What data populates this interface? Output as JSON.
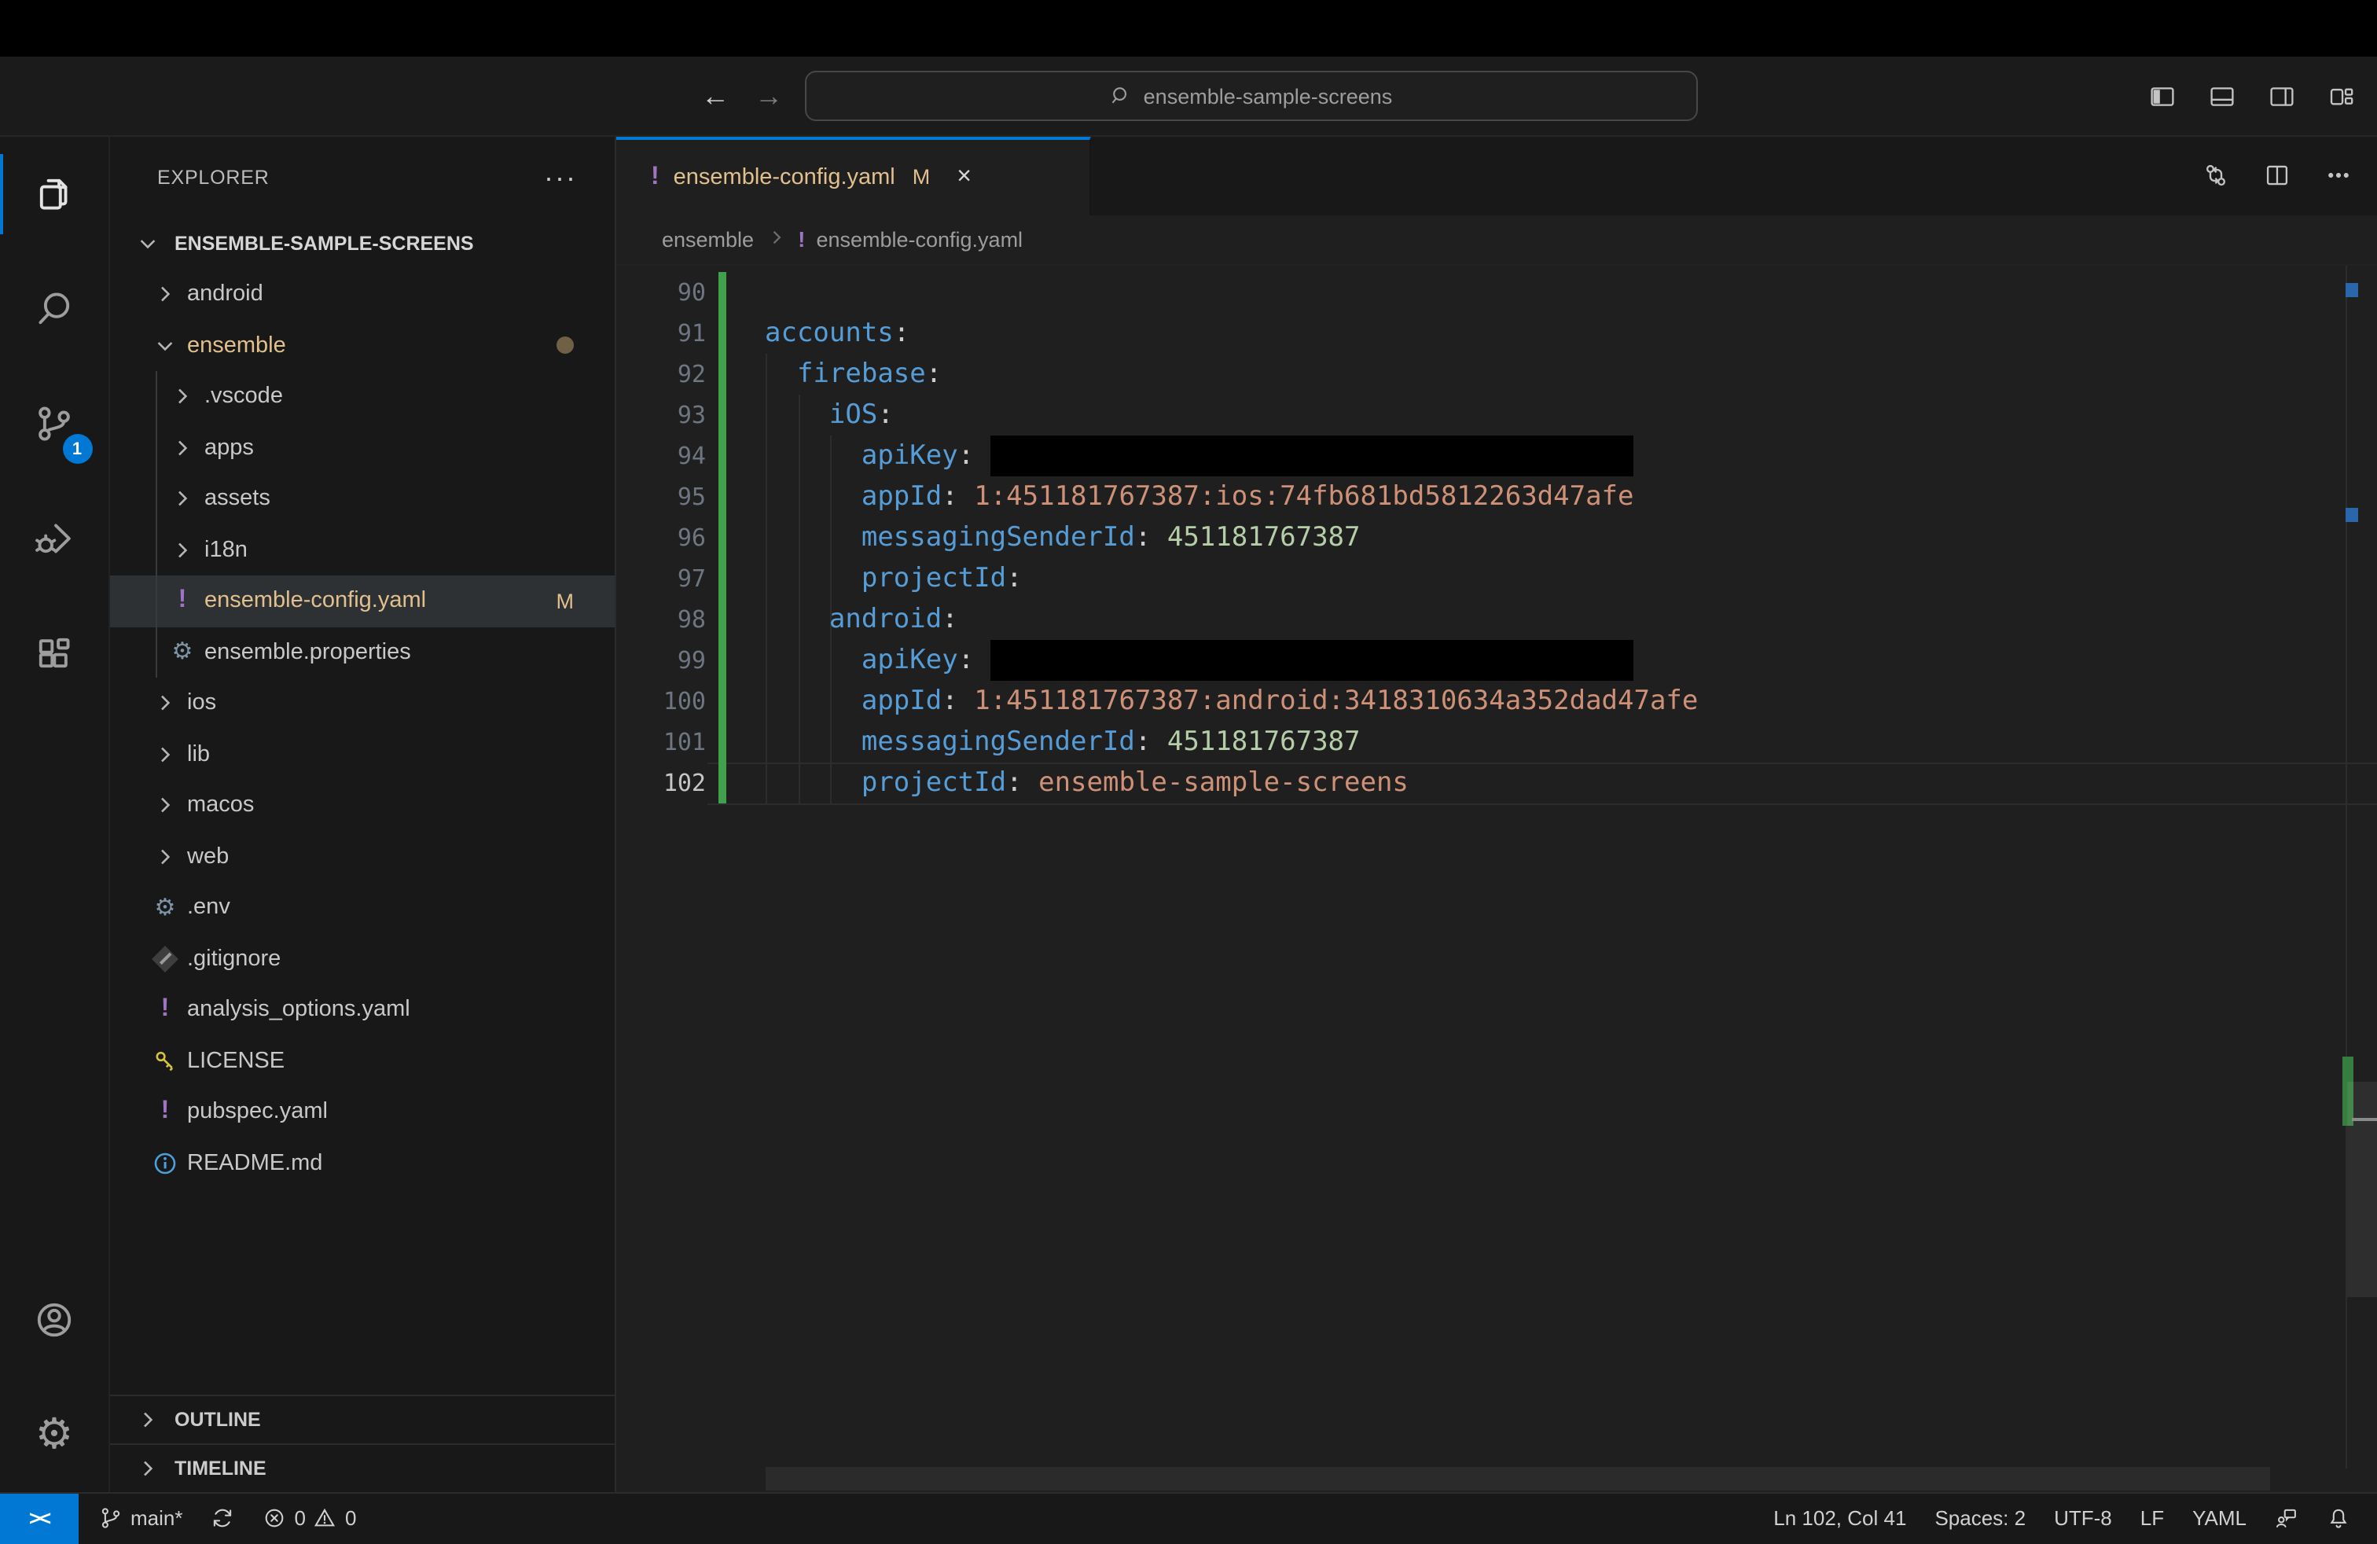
{
  "titlebar": {
    "back": "←",
    "forward": "→",
    "command_center": "ensemble-sample-screens"
  },
  "activity_bar": {
    "scm_badge": "1",
    "items": [
      "explorer",
      "search",
      "source-control",
      "run-and-debug",
      "extensions"
    ],
    "bottom": [
      "accounts",
      "settings"
    ]
  },
  "explorer": {
    "title": "EXPLORER",
    "more": "···",
    "root": "ENSEMBLE-SAMPLE-SCREENS",
    "items": [
      {
        "label": "android",
        "icon": "chevron-right",
        "level": 0
      },
      {
        "label": "ensemble",
        "icon": "chevron-down",
        "level": 0,
        "modified": true,
        "dot": true
      },
      {
        "label": ".vscode",
        "icon": "chevron-right",
        "level": 1
      },
      {
        "label": "apps",
        "icon": "chevron-right",
        "level": 1
      },
      {
        "label": "assets",
        "icon": "chevron-right",
        "level": 1
      },
      {
        "label": "i18n",
        "icon": "chevron-right",
        "level": 1
      },
      {
        "label": "ensemble-config.yaml",
        "icon": "yaml",
        "level": 1,
        "modified": true,
        "selected": true,
        "badge": "M"
      },
      {
        "label": "ensemble.properties",
        "icon": "gear",
        "level": 1
      },
      {
        "label": "ios",
        "icon": "chevron-right",
        "level": 0
      },
      {
        "label": "lib",
        "icon": "chevron-right",
        "level": 0
      },
      {
        "label": "macos",
        "icon": "chevron-right",
        "level": 0
      },
      {
        "label": "web",
        "icon": "chevron-right",
        "level": 0
      },
      {
        "label": ".env",
        "icon": "gear",
        "level": 0
      },
      {
        "label": ".gitignore",
        "icon": "git",
        "level": 0
      },
      {
        "label": "analysis_options.yaml",
        "icon": "yaml",
        "level": 0
      },
      {
        "label": "LICENSE",
        "icon": "key",
        "level": 0
      },
      {
        "label": "pubspec.yaml",
        "icon": "yaml",
        "level": 0
      },
      {
        "label": "README.md",
        "icon": "info",
        "level": 0
      }
    ],
    "sections": [
      "OUTLINE",
      "TIMELINE"
    ]
  },
  "tab": {
    "icon": "!",
    "label": "ensemble-config.yaml",
    "badge": "M",
    "close": "×"
  },
  "breadcrumb": {
    "folder": "ensemble",
    "file": "ensemble-config.yaml"
  },
  "editor": {
    "language": "yaml",
    "lines": [
      {
        "n": "90",
        "tokens": []
      },
      {
        "n": "91",
        "tokens": [
          [
            "k",
            "accounts"
          ],
          [
            "p",
            ":"
          ]
        ]
      },
      {
        "n": "92",
        "tokens": [
          [
            "w",
            "  "
          ],
          [
            "k",
            "firebase"
          ],
          [
            "p",
            ":"
          ]
        ]
      },
      {
        "n": "93",
        "tokens": [
          [
            "w",
            "    "
          ],
          [
            "k",
            "iOS"
          ],
          [
            "p",
            ":"
          ]
        ]
      },
      {
        "n": "94",
        "tokens": [
          [
            "w",
            "      "
          ],
          [
            "k",
            "apiKey"
          ],
          [
            "p",
            ":"
          ],
          [
            "w",
            " "
          ],
          [
            "r",
            ""
          ]
        ]
      },
      {
        "n": "95",
        "tokens": [
          [
            "w",
            "      "
          ],
          [
            "k",
            "appId"
          ],
          [
            "p",
            ":"
          ],
          [
            "w",
            " "
          ],
          [
            "s",
            "1:451181767387:ios:74fb681bd5812263d47afe"
          ]
        ]
      },
      {
        "n": "96",
        "tokens": [
          [
            "w",
            "      "
          ],
          [
            "k",
            "messagingSenderId"
          ],
          [
            "p",
            ":"
          ],
          [
            "w",
            " "
          ],
          [
            "n",
            "451181767387"
          ]
        ]
      },
      {
        "n": "97",
        "tokens": [
          [
            "w",
            "      "
          ],
          [
            "k",
            "projectId"
          ],
          [
            "p",
            ":"
          ]
        ]
      },
      {
        "n": "98",
        "tokens": [
          [
            "w",
            "    "
          ],
          [
            "k",
            "android"
          ],
          [
            "p",
            ":"
          ]
        ]
      },
      {
        "n": "99",
        "tokens": [
          [
            "w",
            "      "
          ],
          [
            "k",
            "apiKey"
          ],
          [
            "p",
            ":"
          ],
          [
            "w",
            " "
          ],
          [
            "r",
            ""
          ]
        ]
      },
      {
        "n": "100",
        "tokens": [
          [
            "w",
            "      "
          ],
          [
            "k",
            "appId"
          ],
          [
            "p",
            ":"
          ],
          [
            "w",
            " "
          ],
          [
            "s",
            "1:451181767387:android:3418310634a352dad47afe"
          ]
        ]
      },
      {
        "n": "101",
        "tokens": [
          [
            "w",
            "      "
          ],
          [
            "k",
            "messagingSenderId"
          ],
          [
            "p",
            ":"
          ],
          [
            "w",
            " "
          ],
          [
            "n",
            "451181767387"
          ]
        ]
      },
      {
        "n": "102",
        "tokens": [
          [
            "w",
            "      "
          ],
          [
            "k",
            "projectId"
          ],
          [
            "p",
            ":"
          ],
          [
            "w",
            " "
          ],
          [
            "s",
            "ensemble-sample-screens"
          ]
        ],
        "current": true
      }
    ]
  },
  "status_bar": {
    "remote": "><",
    "branch": "main*",
    "errors": "0",
    "warnings": "0",
    "right": [
      "Ln 102, Col 41",
      "Spaces: 2",
      "UTF-8",
      "LF",
      "YAML"
    ]
  },
  "colors": {
    "accent": "#0078d4",
    "modified": "#e2c08d",
    "yaml_icon": "#a074c4",
    "key": "#569cd6",
    "string": "#ce9178",
    "number": "#b5cea8",
    "gutter_added": "#41a04b",
    "redaction": "#000000",
    "editor_bg": "#1f1f1f",
    "panel_bg": "#181818"
  }
}
